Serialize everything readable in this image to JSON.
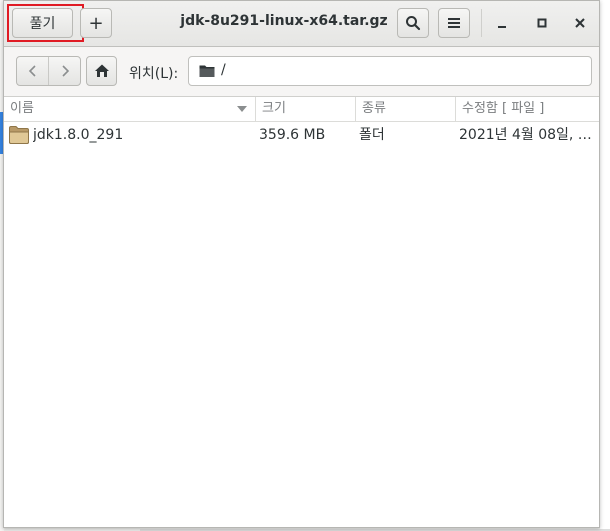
{
  "window": {
    "title": "jdk-8u291-linux-x64.tar.gz"
  },
  "headerbar": {
    "extract_label": "풀기",
    "add_label": "+",
    "minimize_glyph": "—",
    "maximize_glyph": "□",
    "close_glyph": "✕"
  },
  "toolbar": {
    "location_label": "위치(L):",
    "location_path": "/"
  },
  "table": {
    "columns": [
      "이름",
      "크기",
      "종류",
      "수정함 [ 파일 ]"
    ],
    "rows": [
      {
        "name": "jdk1.8.0_291",
        "size": "359.6 MB",
        "type": "폴더",
        "modified": "2021년 4월 08일, …"
      }
    ]
  },
  "colors": {
    "highlight": "#e01b24",
    "folder": "#c9a66b"
  }
}
